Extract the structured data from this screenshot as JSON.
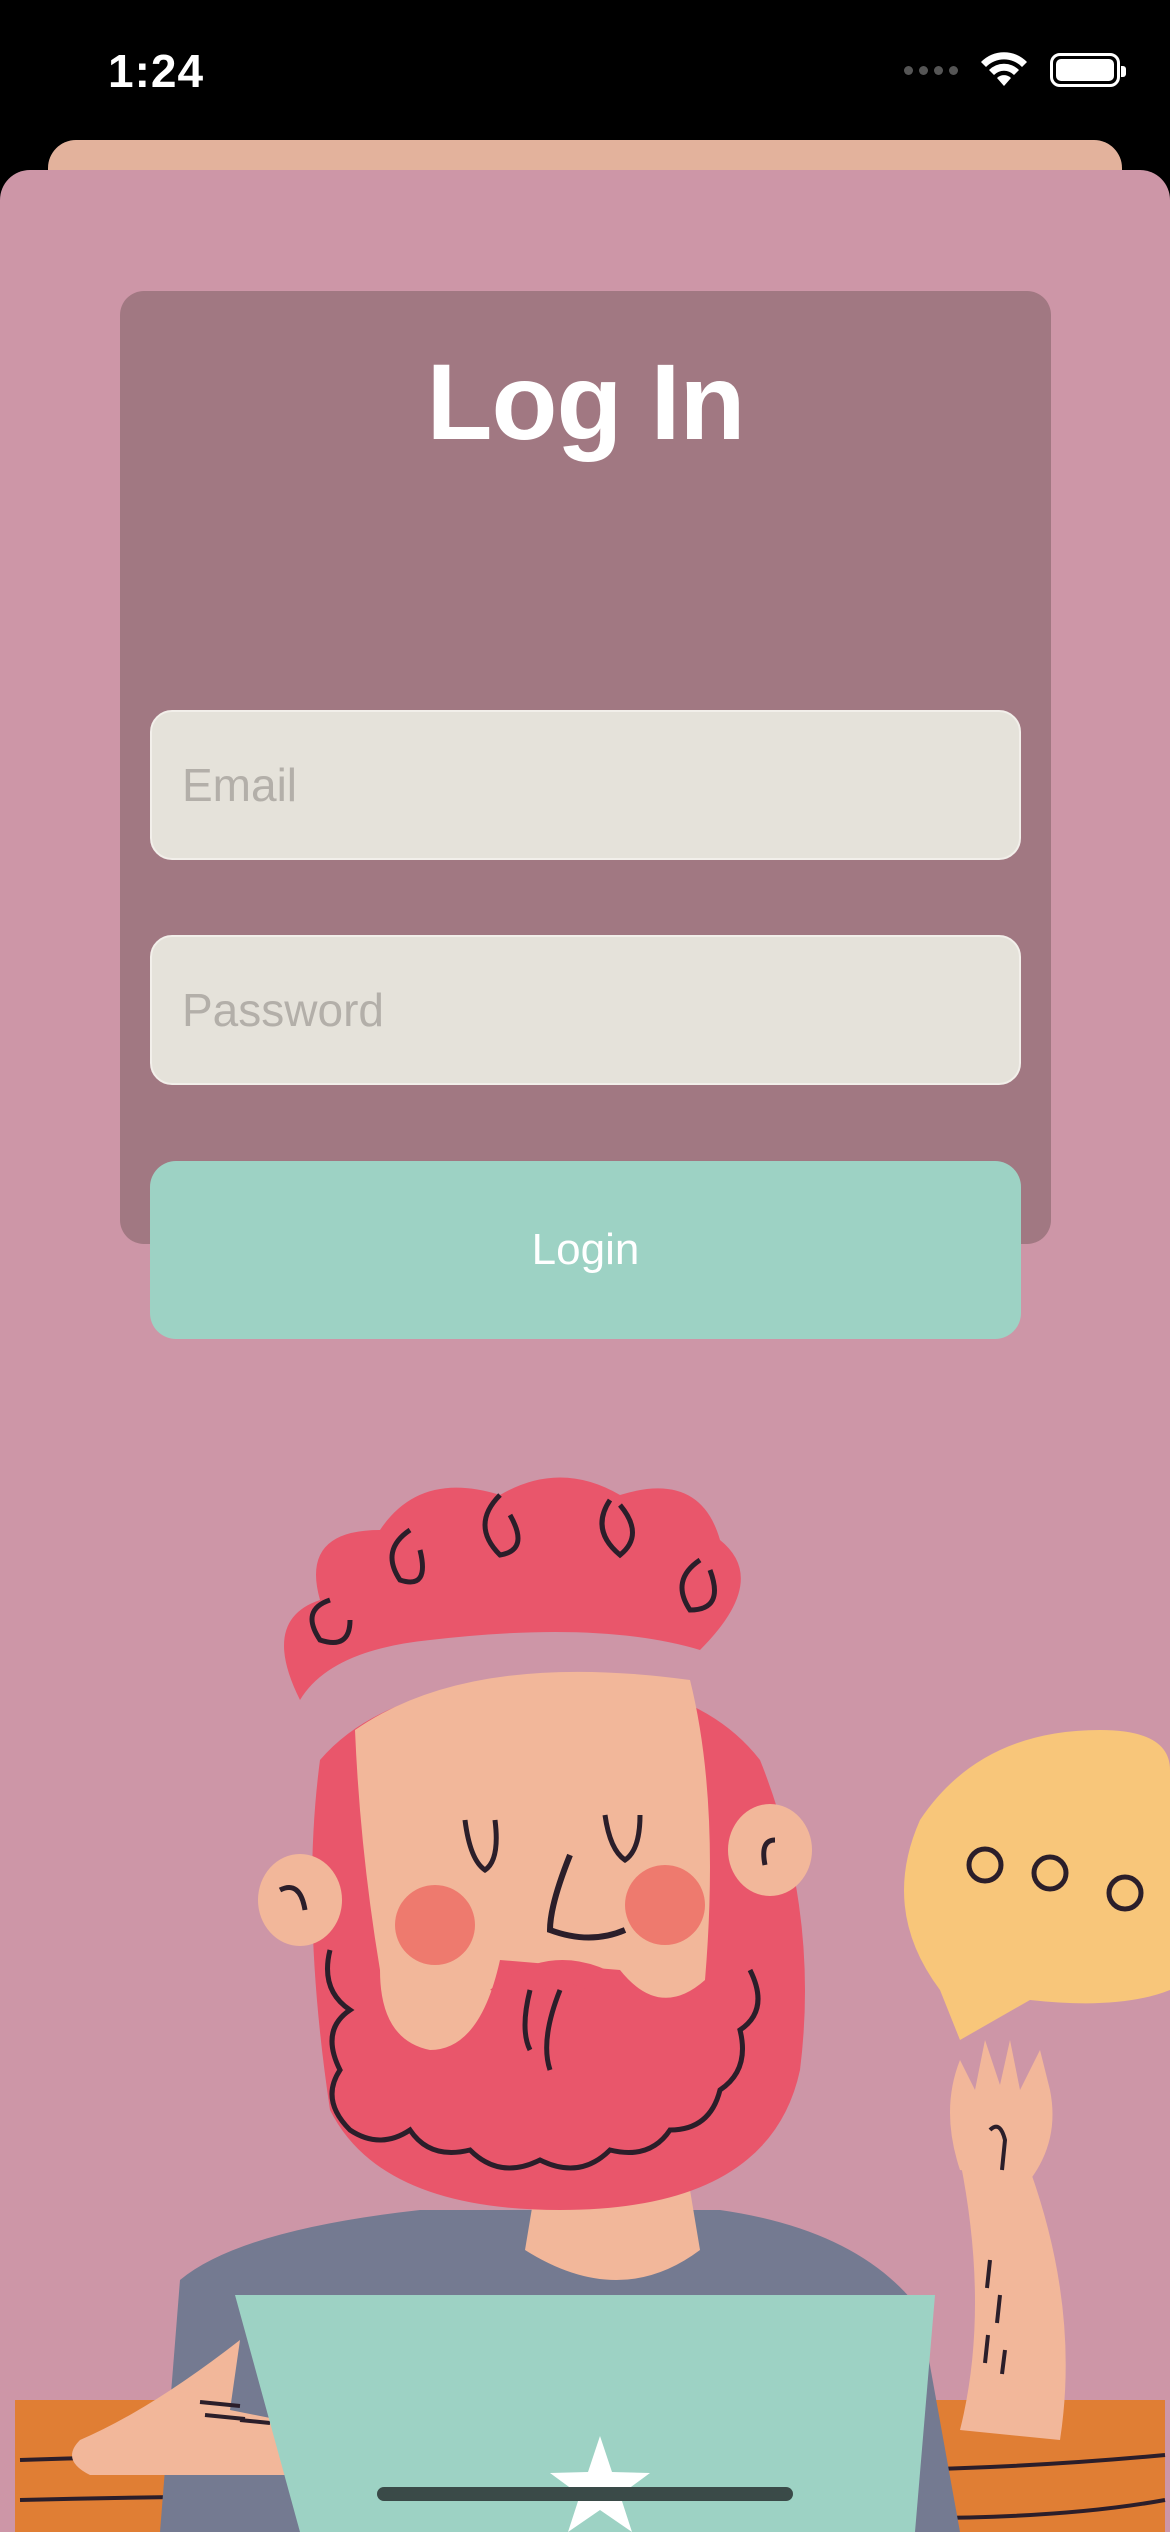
{
  "status_bar": {
    "time": "1:24"
  },
  "login": {
    "title": "Log In",
    "email_placeholder": "Email",
    "password_placeholder": "Password",
    "button_label": "Login"
  },
  "colors": {
    "background": "#cd96a7",
    "card": "#a17882",
    "input": "#e5e2da",
    "button": "#9dd2c4",
    "peek_sheet": "#e3b29c"
  },
  "illustration": {
    "subject": "bearded man with laptop and speech bubble"
  }
}
